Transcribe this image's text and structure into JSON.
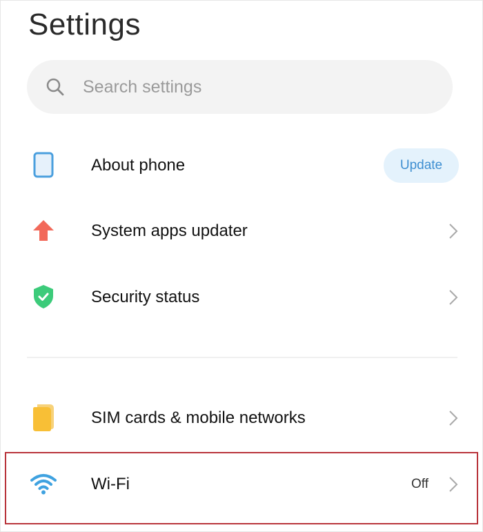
{
  "header": {
    "title": "Settings"
  },
  "search": {
    "placeholder": "Search settings"
  },
  "items": [
    {
      "label": "About phone",
      "icon": "phone-icon",
      "action_label": "Update"
    },
    {
      "label": "System apps updater",
      "icon": "arrow-up-icon"
    },
    {
      "label": "Security status",
      "icon": "shield-check-icon"
    },
    {
      "label": "SIM cards & mobile networks",
      "icon": "sim-card-icon"
    },
    {
      "label": "Wi-Fi",
      "icon": "wifi-icon",
      "value": "Off"
    }
  ],
  "colors": {
    "update_bg": "#e4f2fc",
    "update_text": "#3d8ed1",
    "highlight_border": "#b8333a"
  }
}
